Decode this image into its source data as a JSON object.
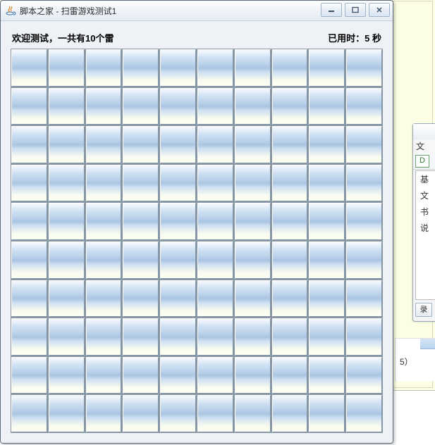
{
  "window": {
    "title": "脚本之家 - 扫雷游戏测试1",
    "icon_name": "java-cup-icon"
  },
  "controls": {
    "minimize_name": "minimize-icon",
    "maximize_name": "maximize-icon",
    "close_name": "close-icon"
  },
  "status": {
    "welcome_label": "欢迎测试，一共有10个雷",
    "timer_label": "已用时：5 秒"
  },
  "board": {
    "rows": 10,
    "cols": 10,
    "mines": 10,
    "elapsed_seconds": 5
  },
  "side_window": {
    "menu_label": "文",
    "toolbar_glyph": "D",
    "body_lines": [
      "基",
      "文",
      "书",
      "说",
      ""
    ],
    "bottom_tab_label": "录"
  },
  "corner_fragment": {
    "text": "5）"
  }
}
